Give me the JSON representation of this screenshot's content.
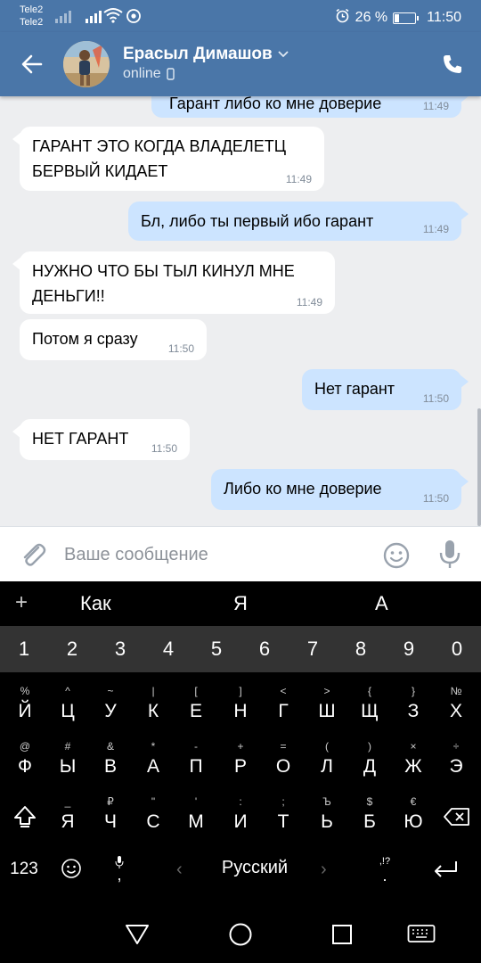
{
  "status_bar": {
    "carrier_1": "Tele2",
    "carrier_2": "Tele2",
    "battery": "26 %",
    "battery_level": 0.26,
    "time": "11:50",
    "icons": [
      "signal-icon",
      "signal-icon",
      "wifi-icon",
      "chrome-icon",
      "alarm-icon",
      "battery-icon"
    ]
  },
  "header": {
    "contact_name": "Ерасыл Димашов",
    "status": "online",
    "icons": [
      "back-arrow-icon",
      "chevron-down-icon",
      "mobile-icon",
      "phone-icon"
    ]
  },
  "messages": [
    {
      "dir": "out",
      "text": "Гарант либо ко мне доверие",
      "time": "11:49"
    },
    {
      "dir": "in",
      "text": "ГАРАНТ ЭТО КОГДА ВЛАДЕЛЕТЦ\nБЕРВЫЙ КИДАЕТ",
      "time": "11:49"
    },
    {
      "dir": "out",
      "text": "Бл, либо ты первый ибо гарант",
      "time": "11:49"
    },
    {
      "dir": "in",
      "text": "НУЖНО ЧТО БЫ ТЫЛ КИНУЛ МНЕ\nДЕНЬГИ!!",
      "time": "11:49"
    },
    {
      "dir": "in",
      "text": "Потом я сразу",
      "time": "11:50"
    },
    {
      "dir": "out",
      "text": "Нет гарант",
      "time": "11:50"
    },
    {
      "dir": "in",
      "text": "НЕТ ГАРАНТ",
      "time": "11:50"
    },
    {
      "dir": "out",
      "text": "Либо ко мне доверие",
      "time": "11:50"
    }
  ],
  "composer": {
    "placeholder": "Ваше сообщение",
    "icons": [
      "paperclip-icon",
      "emoji-icon",
      "microphone-icon"
    ]
  },
  "keyboard": {
    "suggestions": [
      "Как",
      "Я",
      "А"
    ],
    "numbers": [
      "1",
      "2",
      "3",
      "4",
      "5",
      "6",
      "7",
      "8",
      "9",
      "0"
    ],
    "row1": [
      [
        "%",
        "Й"
      ],
      [
        "^",
        "Ц"
      ],
      [
        "~",
        "У"
      ],
      [
        "|",
        "К"
      ],
      [
        "[",
        "Е"
      ],
      [
        "]",
        "Н"
      ],
      [
        "<",
        "Г"
      ],
      [
        ">",
        "Ш"
      ],
      [
        "{",
        "Щ"
      ],
      [
        "}",
        "З"
      ],
      [
        "№",
        "Х"
      ]
    ],
    "row2": [
      [
        "@",
        "Ф"
      ],
      [
        "#",
        "Ы"
      ],
      [
        "&",
        "В"
      ],
      [
        "*",
        "А"
      ],
      [
        "-",
        "П"
      ],
      [
        "+",
        "Р"
      ],
      [
        "=",
        "О"
      ],
      [
        "(",
        "Л"
      ],
      [
        ")",
        "Д"
      ],
      [
        "×",
        "Ж"
      ],
      [
        "÷",
        "Э"
      ]
    ],
    "row3": [
      [
        "_",
        "Я"
      ],
      [
        "₽",
        "Ч"
      ],
      [
        "\"",
        "С"
      ],
      [
        "'",
        "М"
      ],
      [
        ":",
        "И"
      ],
      [
        ";",
        "Т"
      ],
      [
        "Ъ",
        "Ь"
      ],
      [
        "$",
        "Б"
      ],
      [
        "€",
        "Ю"
      ]
    ],
    "numeric_key": "123",
    "mic_key": ",",
    "space_label": "Русский",
    "punct_top": ",!?",
    "punct_bottom": "."
  },
  "nav_bar": {
    "icons": [
      "back-triangle-icon",
      "home-circle-icon",
      "recents-square-icon",
      "keyboard-toggle-icon"
    ]
  }
}
